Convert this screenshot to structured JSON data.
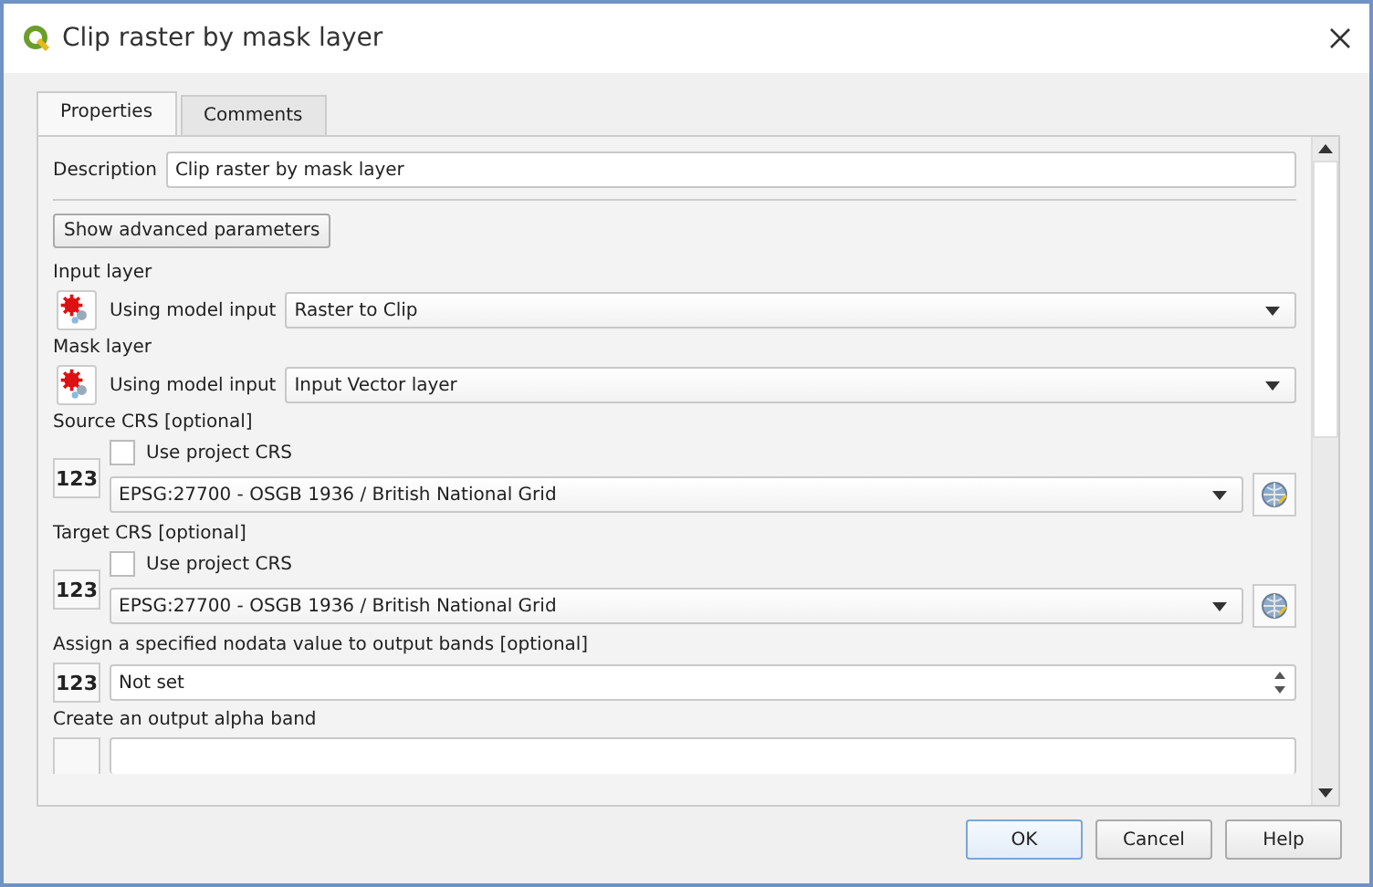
{
  "window": {
    "title": "Clip raster by mask layer"
  },
  "tabs": [
    {
      "label": "Properties",
      "selected": true
    },
    {
      "label": "Comments",
      "selected": false
    }
  ],
  "description": {
    "label": "Description",
    "value": "Clip raster by mask layer"
  },
  "advanced_button": "Show advanced parameters",
  "parameters": [
    {
      "kind": "model_input",
      "label": "Input layer",
      "mode": "Using model input",
      "value": "Raster to Clip"
    },
    {
      "kind": "model_input",
      "label": "Mask layer",
      "mode": "Using model input",
      "value": "Input Vector layer"
    },
    {
      "kind": "crs",
      "label": "Source CRS [optional]",
      "source_button": "123",
      "checkbox_label": "Use project CRS",
      "checked": false,
      "value": "EPSG:27700 - OSGB 1936 / British National Grid"
    },
    {
      "kind": "crs",
      "label": "Target CRS [optional]",
      "source_button": "123",
      "checkbox_label": "Use project CRS",
      "checked": false,
      "value": "EPSG:27700 - OSGB 1936 / British National Grid"
    },
    {
      "kind": "number",
      "label": "Assign a specified nodata value to output bands [optional]",
      "source_button": "123",
      "value": "Not set"
    },
    {
      "kind": "partial",
      "label": "Create an output alpha band"
    }
  ],
  "buttons": [
    {
      "label": "OK",
      "default": true
    },
    {
      "label": "Cancel",
      "default": false
    },
    {
      "label": "Help",
      "default": false
    }
  ]
}
